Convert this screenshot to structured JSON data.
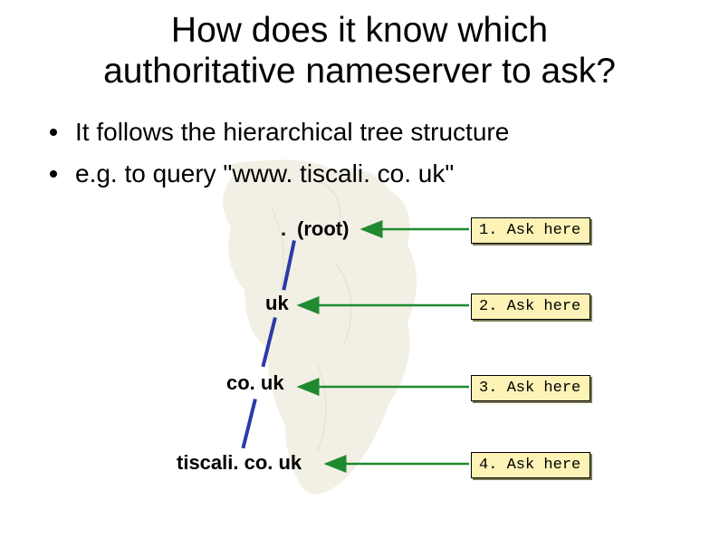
{
  "title_line1": "How does it know which",
  "title_line2": "authoritative nameserver to ask?",
  "bullets": [
    "It follows the hierarchical tree structure",
    "e.g. to query \"www. tiscali. co. uk\""
  ],
  "tree": {
    "root_dot": ".",
    "root_label": "(root)",
    "level1": "uk",
    "level2": "co. uk",
    "level3": "tiscali. co. uk"
  },
  "callouts": [
    "1. Ask here",
    "2. Ask here",
    "3. Ask here",
    "4. Ask here"
  ],
  "colors": {
    "callout_bg": "#fdf3b7",
    "line": "#2b3aa8",
    "arrow": "#1f8a2f"
  }
}
